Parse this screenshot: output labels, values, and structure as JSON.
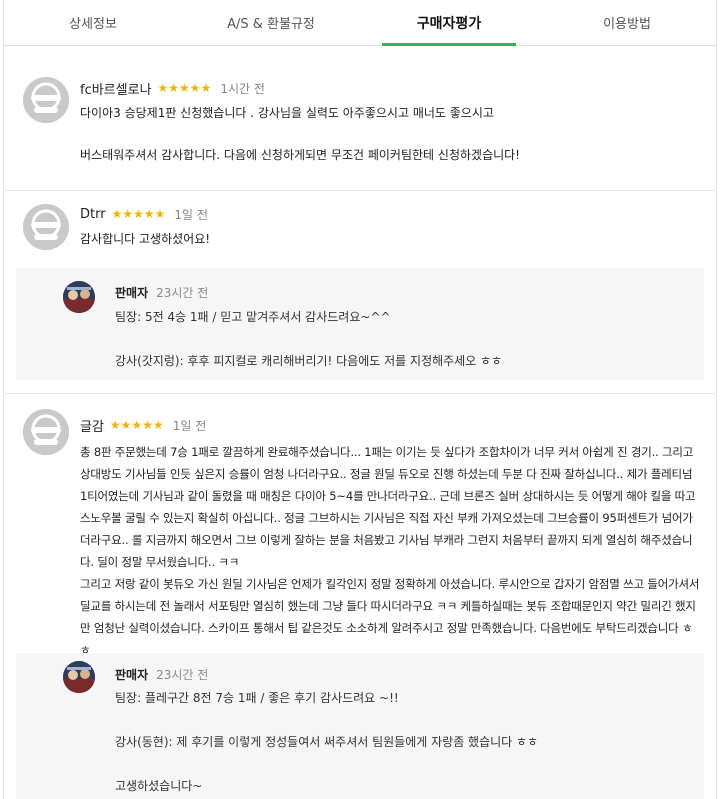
{
  "tabs": [
    {
      "label": "상세정보",
      "active": false
    },
    {
      "label": "A/S & 환불규정",
      "active": false
    },
    {
      "label": "구매자평가",
      "active": true
    },
    {
      "label": "이용방법",
      "active": false
    }
  ],
  "reviews": [
    {
      "name": "fc바르셀로나",
      "stars": "★★★★★",
      "rating": 5,
      "time": "1시간 전",
      "body": "다이아3 승당제1판 신청했습니다 . 강사님을 실력도 아주좋으시고 매너도 좋으시고\n\n버스태워주셔서 감사합니다. 다음에 신청하게되면 무조건 페이커팀한테 신청하겠습니다!"
    },
    {
      "name": "Dtrr",
      "stars": "★★★★★",
      "rating": 5,
      "time": "1일 전",
      "body": "감사합니다 고생하셨어요!",
      "reply": {
        "name": "판매자",
        "time": "23시간 전",
        "body": "팀장: 5전 4승 1패 / 믿고 맡겨주셔서 감사드려요~^^\n\n강사(갓지렁): 후후 피지컬로 캐리해버리기! 다음에도 저를 지정해주세오 ㅎㅎ"
      }
    },
    {
      "name": "글감",
      "stars": "★★★★★",
      "rating": 5,
      "time": "1일 전",
      "body": "총 8판 주문했는데 7승 1패로 깔끔하게 완료해주셨습니다... 1패는 이기는 듯 싶다가 조합차이가 너무 커서 아쉽게 진 경기.. 그리고 상대방도 기사님들 인듯 싶은지 승률이 엄청 나더라구요.. 정글 원딜 듀오로 진행 하셨는데 두분 다 진짜 잘하십니다.. 제가 플레티넘 1티어였는데 기사님과 같이 돌렸을 때 매칭은 다이아 5~4를 만나더라구요.. 근데 브론즈 실버 상대하시는 듯 어떻게 해야 킬을 따고 스노우볼 굴릴 수 있는지 확실히 아십니다.. 정글 그브하시는 기사님은 직접 자신 부캐 가져오셨는데 그브승률이 95퍼센트가 넘어가더라구요.. 롤 지금까지 해오면서 그브 이렇게 잘하는 분을 처음봤고 기사님 부캐라 그런지 처음부터 끝까지 되게 열심히 해주셨습니다. 딜이 정말 무서웠습니다.. ㅋㅋ\n그리고 저랑 같이 봇듀오 가신 원딜 기사님은 언제가 킬각인지 정말 정확하게 아셨습니다. 루시안으로 갑자기 암점멸 쓰고 들어가셔서 딜교를 하시는데 전 놀래서 서포팅만 열심히 했는데 그냥 들다 따시더라구요 ㅋㅋ 케틀하실때는 봇듀 조합때문인지 약간 밀리긴 했지만 엄청난 실력이셨습니다. 스카이프 통해서 팁 같은것도 소소하게 알려주시고 정말 만족했습니다. 다음번에도 부탁드리겠습니다 ㅎㅎ",
      "reply": {
        "name": "판매자",
        "time": "23시간 전",
        "body": "팀장: 플레구간 8전 7승 1패 / 좋은 후기 감사드려요 ~!!\n\n강사(동현): 제 후기를 이렇게 정성들여서 써주셔서 팀원들에게 자랑좀 했습니다 ㅎㅎ\n\n고생하셨습니다~"
      }
    }
  ],
  "colors": {
    "accent_green": "#2dbd3a",
    "star_gold": "#f5b300",
    "avatar_gray": "#c9c9c9",
    "reply_bg": "#f6f6f6"
  },
  "icons": {
    "buyer_avatar": "default-user-avatar-icon",
    "seller_avatar": "seller-profile-image"
  }
}
